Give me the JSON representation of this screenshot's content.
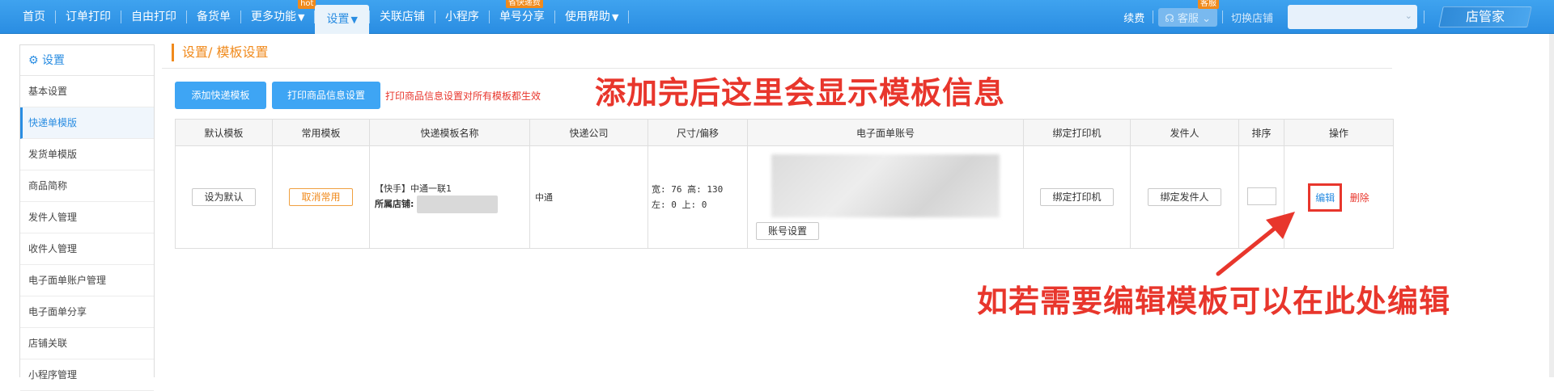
{
  "nav": {
    "items": [
      {
        "label": "首页"
      },
      {
        "label": "订单打印"
      },
      {
        "label": "自由打印"
      },
      {
        "label": "备货单"
      },
      {
        "label": "更多功能",
        "badge": "hot"
      },
      {
        "label": "设置",
        "active": true
      },
      {
        "label": "关联店铺"
      },
      {
        "label": "小程序"
      },
      {
        "label": "单号分享",
        "badge": "省快递费"
      },
      {
        "label": "使用帮助"
      }
    ],
    "renew": "续费",
    "kefu": "客服",
    "kefu_badge": "客服",
    "switch_shop": "切换店铺",
    "brand": "店管家"
  },
  "sidebar": {
    "title": "设置",
    "items": [
      {
        "label": "基本设置"
      },
      {
        "label": "快递单模版",
        "active": true
      },
      {
        "label": "发货单模版"
      },
      {
        "label": "商品简称"
      },
      {
        "label": "发件人管理"
      },
      {
        "label": "收件人管理"
      },
      {
        "label": "电子面单账户管理"
      },
      {
        "label": "电子面单分享"
      },
      {
        "label": "店铺关联"
      },
      {
        "label": "小程序管理"
      }
    ]
  },
  "main": {
    "breadcrumb": "设置/ 模板设置",
    "add_button": "添加快递模板",
    "print_info_button": "打印商品信息设置",
    "tip": "打印商品信息设置对所有模板都生效",
    "annotation_top": "添加完后这里会显示模板信息",
    "annotation_bottom": "如若需要编辑模板可以在此处编辑"
  },
  "table": {
    "headers": [
      "默认模板",
      "常用模板",
      "快递模板名称",
      "快递公司",
      "尺寸/偏移",
      "电子面单账号",
      "绑定打印机",
      "发件人",
      "排序",
      "操作"
    ],
    "row": {
      "set_default": "设为默认",
      "cancel_common": "取消常用",
      "template_name": "【快手】中通一联1",
      "shop_label": "所属店铺:",
      "company": "中通",
      "size_line1": "宽: 76 高: 130",
      "size_line2": "左: 0 上: 0",
      "account_settings": "账号设置",
      "bind_printer": "绑定打印机",
      "bind_sender": "绑定发件人",
      "edit": "编辑",
      "delete": "删除"
    }
  },
  "colors": {
    "nav_blue": "#2a8de2",
    "accent_orange": "#f08a1c",
    "annotation_red": "#e8362c",
    "button_blue": "#3ea5f4"
  }
}
